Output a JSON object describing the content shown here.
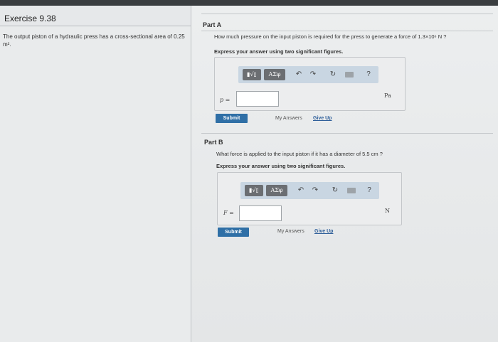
{
  "header": {
    "title": "Exercise 9.38"
  },
  "problem": {
    "text_before": "The output piston of a hydraulic press has a cross-sectional area of ",
    "area_value": "0.25 m²",
    "text_after": "."
  },
  "part_a": {
    "title": "Part A",
    "question_before": "How much pressure on the input piston is required for the press to generate a force of ",
    "force_value": "1.3×10⁶ N",
    "question_after": " ?",
    "instruction": "Express your answer using two significant figures.",
    "variable": "p =",
    "input_value": "",
    "unit": "Pa",
    "submit_label": "Submit",
    "my_answers_label": "My Answers",
    "give_up_label": "Give Up"
  },
  "part_b": {
    "title": "Part B",
    "question_before": "What force is applied to the input piston if it has a diameter of ",
    "diameter_value": "5.5 cm",
    "question_after": " ?",
    "instruction": "Express your answer using two significant figures.",
    "variable": "F =",
    "input_value": "",
    "unit": "N",
    "submit_label": "Submit",
    "my_answers_label": "My Answers",
    "give_up_label": "Give Up"
  },
  "toolbar": {
    "template_label": "▮√▯",
    "symbols_label": "ΑΣφ",
    "undo_icon": "undo-icon",
    "redo_icon": "redo-icon",
    "reset_icon": "reset-icon",
    "keyboard_icon": "keyboard-icon",
    "help_label": "?"
  }
}
